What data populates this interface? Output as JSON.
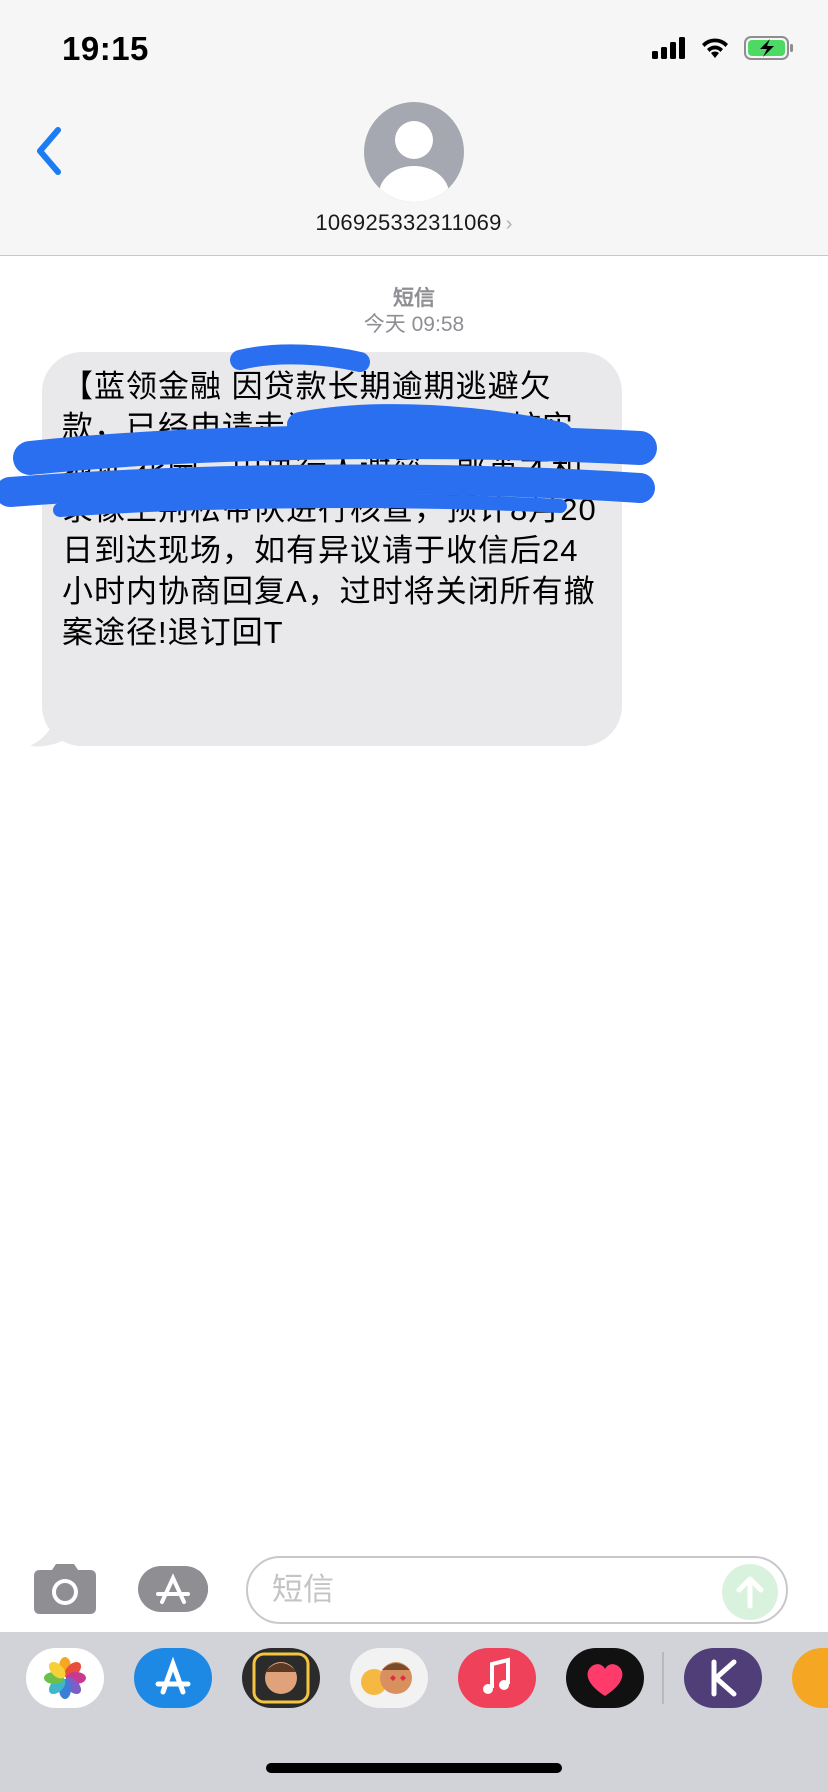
{
  "status_bar": {
    "time": "19:15"
  },
  "header": {
    "contact": "106925332311069"
  },
  "conversation": {
    "service_label": "短信",
    "timestamp": "今天 09:58",
    "message": "【蓝领金融 因贷款长期逾期逃避欠款，已经申请走访调查取证，已核实地址 花园，由执行人谢垒、郭英才和录像王荆松带队进行核查，预计8月20日到达现场，如有异议请于收信后24小时内协商回复A，过时将关闭所有撤案途径!退订回T"
  },
  "input": {
    "placeholder": "短信"
  },
  "app_drawer": {
    "apps": [
      "photos-icon",
      "app-store-icon",
      "memoji-icon",
      "animoji-icon",
      "music-icon",
      "heart-app-icon",
      "k-app-icon",
      "weibo-icon"
    ]
  },
  "colors": {
    "accent": "#1c7cf4",
    "bubble": "#e9e9eb",
    "redaction": "#2a6ff0",
    "bar": "#f6f6f6"
  }
}
